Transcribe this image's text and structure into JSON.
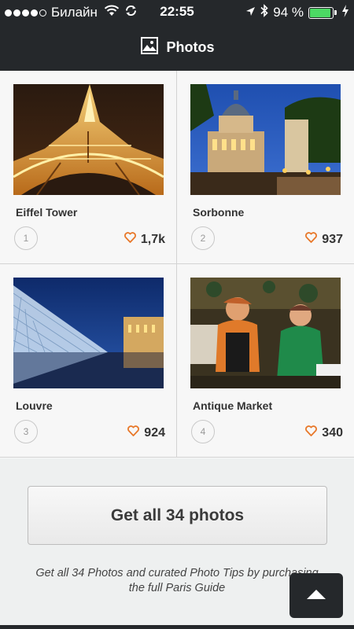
{
  "status_bar": {
    "carrier": "Билайн",
    "time": "22:55",
    "battery_percent": "94 %",
    "battery_level": 0.94,
    "signal_bars": 4
  },
  "nav": {
    "title": "Photos",
    "icon": "photo-icon"
  },
  "photos": [
    {
      "title": "Eiffel Tower",
      "rank": "1",
      "likes": "1,7k"
    },
    {
      "title": "Sorbonne",
      "rank": "2",
      "likes": "937"
    },
    {
      "title": "Louvre",
      "rank": "3",
      "likes": "924"
    },
    {
      "title": "Antique Market",
      "rank": "4",
      "likes": "340"
    }
  ],
  "cta": {
    "label": "Get all 34 photos"
  },
  "promo_text": "Get all 34 Photos and curated Photo Tips by purchasing the full Paris Guide",
  "colors": {
    "bar": "#25282b",
    "accent_heart": "#e8782a",
    "battery": "#4cd964"
  }
}
